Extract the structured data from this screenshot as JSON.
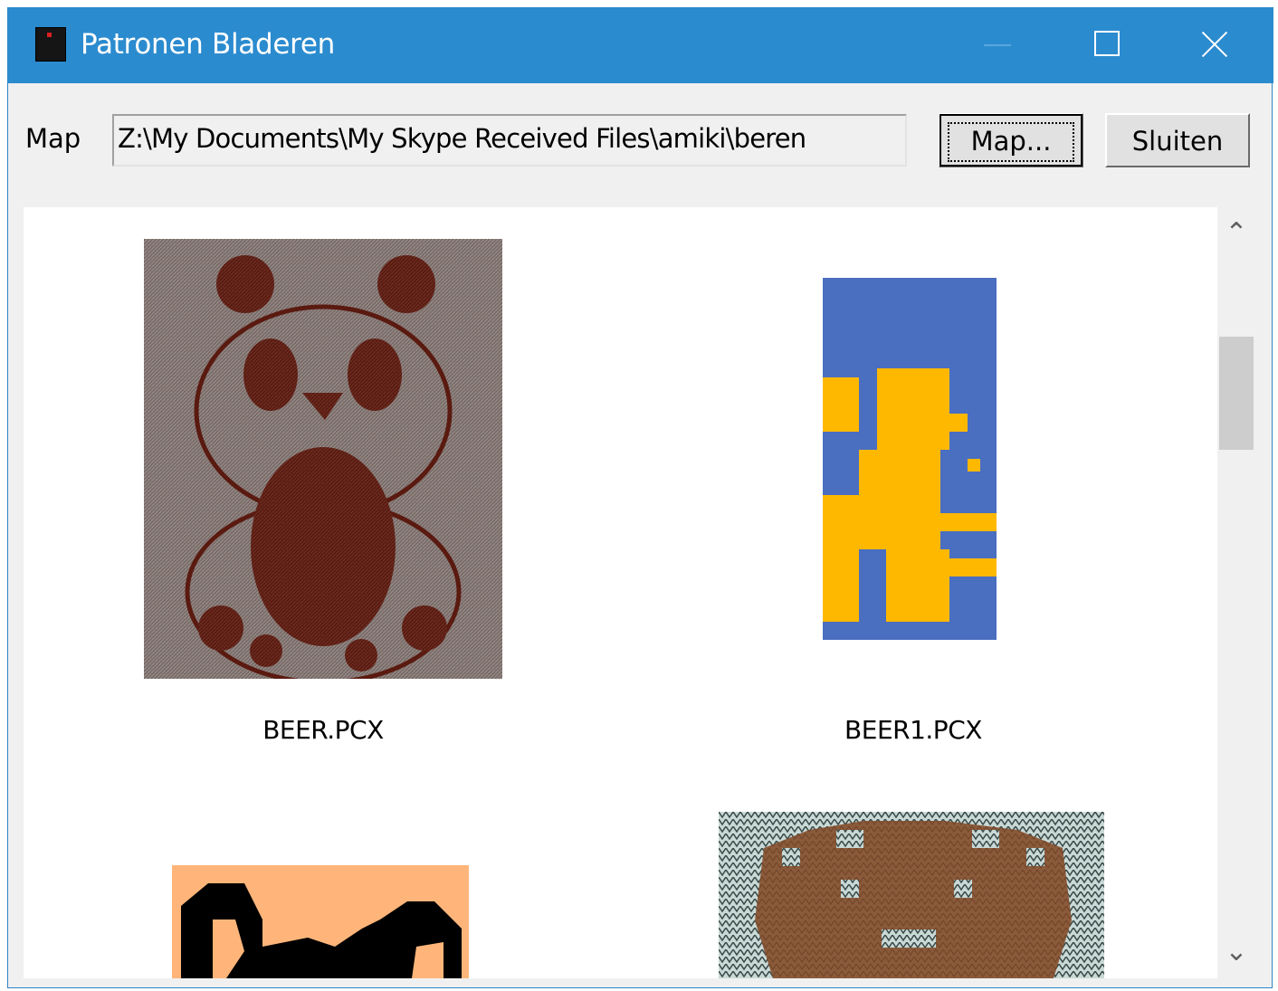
{
  "window": {
    "title": "Patronen Bladeren",
    "minimize_icon": "minimize-icon",
    "maximize_icon": "maximize-icon",
    "close_icon": "close-icon"
  },
  "toolbar": {
    "map_label": "Map",
    "path_value": "Z:\\My Documents\\My Skype Received Files\\amiki\\beren",
    "map_button": "Map...",
    "close_button": "Sluiten"
  },
  "thumbnails": [
    {
      "label": "BEER.PCX",
      "colors": {
        "background": "#7a6b67",
        "foreground": "#5a1a10"
      }
    },
    {
      "label": "BEER1.PCX",
      "colors": {
        "background": "#4a6ec0",
        "foreground": "#ffb800"
      }
    },
    {
      "label": "",
      "colors": {
        "background": "#ffb57a",
        "foreground": "#000000"
      }
    },
    {
      "label": "",
      "colors": {
        "background": "#c9d9d6",
        "foreground": "#8a5a3a"
      }
    }
  ],
  "scrollbar": {
    "up_icon": "chevron-up-icon",
    "down_icon": "chevron-down-icon",
    "up_glyph": "⌃",
    "down_glyph": "⌄"
  }
}
